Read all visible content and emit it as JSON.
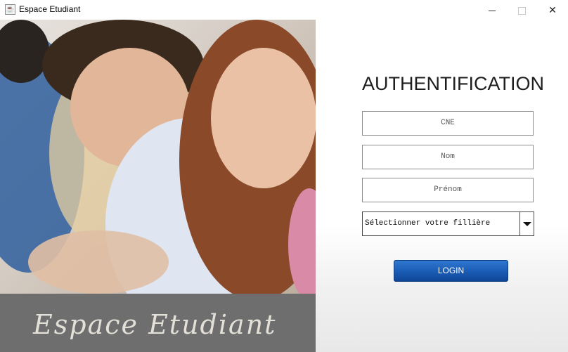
{
  "window": {
    "title": "Espace Etudiant",
    "app_icon": "java-icon"
  },
  "controls": {
    "minimize": "minimize-icon",
    "maximize": "maximize-icon",
    "close": "close-icon",
    "close_glyph": "✕"
  },
  "left_panel": {
    "banner_text": "Espace Etudiant"
  },
  "form": {
    "heading": "AUTHENTIFICATION",
    "cne_placeholder": "CNE",
    "nom_placeholder": "Nom",
    "prenom_placeholder": "Prénom",
    "filiere_selected": "Sélectionner votre fillière",
    "login_label": "LOGIN"
  },
  "colors": {
    "login_button": "#1a5bb4",
    "banner": "#6e6e6e"
  }
}
